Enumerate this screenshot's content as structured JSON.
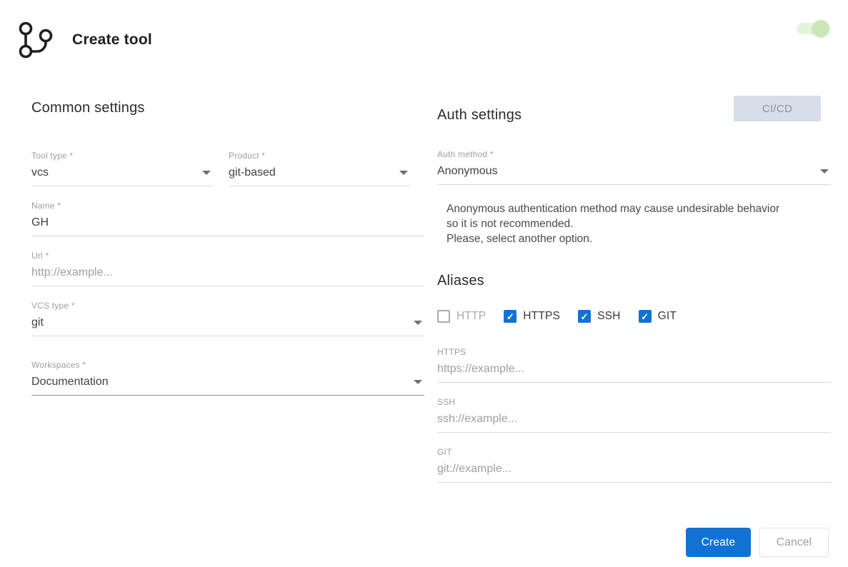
{
  "header": {
    "title": "Create tool",
    "toggle_state": "on"
  },
  "common": {
    "heading": "Common settings",
    "fields": {
      "tool_type": {
        "label": "Tool type *",
        "value": "vcs"
      },
      "product": {
        "label": "Product *",
        "value": "git-based"
      },
      "name": {
        "label": "Name *",
        "value": "GH"
      },
      "url": {
        "label": "Url *",
        "placeholder": "http://example..."
      },
      "vcs_type": {
        "label": "VCS type *",
        "value": "git"
      },
      "workspaces": {
        "label": "Workspaces *",
        "value": "Documentation"
      }
    }
  },
  "auth": {
    "heading": "Auth settings",
    "cicd_label": "CI/CD",
    "auth_method": {
      "label": "Auth method *",
      "value": "Anonymous"
    },
    "warning": "Anonymous authentication method may cause undesirable behavior so it is not recommended.\nPlease, select another option."
  },
  "aliases": {
    "heading": "Aliases",
    "options": [
      {
        "label": "HTTP",
        "checked": false
      },
      {
        "label": "HTTPS",
        "checked": true
      },
      {
        "label": "SSH",
        "checked": true
      },
      {
        "label": "GIT",
        "checked": true
      }
    ],
    "fields": [
      {
        "label": "HTTPS",
        "placeholder": "https://example..."
      },
      {
        "label": "SSH",
        "placeholder": "ssh://example..."
      },
      {
        "label": "GIT",
        "placeholder": "git://example..."
      }
    ]
  },
  "footer": {
    "create_label": "Create",
    "cancel_label": "Cancel"
  },
  "colors": {
    "accent_blue": "#1272d4",
    "checkbox_blue": "#1272d4",
    "toggle_track_green": "#e4f4da",
    "toggle_knob_green": "#c9e8b6",
    "cicd_bg": "#d8ddeb",
    "label_gray": "#9e9e9e",
    "value_dark": "#424242"
  }
}
